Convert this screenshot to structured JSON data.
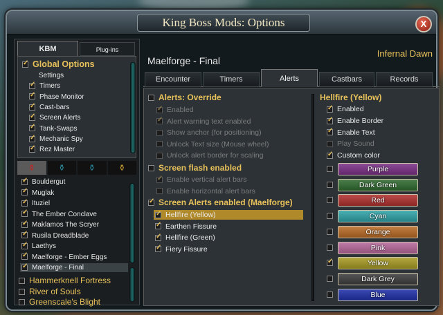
{
  "window": {
    "title": "King Boss Mods: Options",
    "close_label": "X"
  },
  "left_tabs": [
    "KBM",
    "Plug-ins"
  ],
  "options_tree": {
    "root": {
      "label": "Global Options",
      "checked": true
    },
    "items": [
      {
        "label": "Settings",
        "checked": null
      },
      {
        "label": "Timers",
        "checked": true
      },
      {
        "label": "Phase Monitor",
        "checked": true
      },
      {
        "label": "Cast-bars",
        "checked": true
      },
      {
        "label": "Screen Alerts",
        "checked": true
      },
      {
        "label": "Tank-Swaps",
        "checked": true
      },
      {
        "label": "Mechanic Spy",
        "checked": true
      },
      {
        "label": "Rez Master",
        "checked": true
      }
    ]
  },
  "boss_list": [
    {
      "label": "Bouldergut",
      "checked": true,
      "selected": false
    },
    {
      "label": "Muglak",
      "checked": true,
      "selected": false
    },
    {
      "label": "Ituziel",
      "checked": true,
      "selected": false
    },
    {
      "label": "The Ember Conclave",
      "checked": true,
      "selected": false
    },
    {
      "label": "Maklamos The Scryer",
      "checked": true,
      "selected": false
    },
    {
      "label": "Rusila Dreadblade",
      "checked": true,
      "selected": false
    },
    {
      "label": "Laethys",
      "checked": true,
      "selected": false
    },
    {
      "label": "Maelforge - Ember Eggs",
      "checked": true,
      "selected": false
    },
    {
      "label": "Maelforge - Final",
      "checked": true,
      "selected": true
    }
  ],
  "zones": [
    {
      "label": "Hammerknell Fortress",
      "checked": false
    },
    {
      "label": "River of Souls",
      "checked": false
    },
    {
      "label": "Greenscale's Blight",
      "checked": false
    }
  ],
  "header": {
    "encounter_name": "Maelforge - Final",
    "difficulty": "Infernal Dawn"
  },
  "tabs": [
    "Encounter",
    "Timers",
    "Alerts",
    "Castbars",
    "Records"
  ],
  "active_tab": "Alerts",
  "alerts": {
    "override": {
      "label": "Alerts: Override",
      "checked": false
    },
    "override_items": [
      {
        "label": "Enabled",
        "checked": true
      },
      {
        "label": "Alert warning text enabled",
        "checked": true
      },
      {
        "label": "Show anchor (for positioning)",
        "checked": false
      },
      {
        "label": "Unlock Text size (Mouse wheel)",
        "checked": false
      },
      {
        "label": "Unlock alert border for scaling",
        "checked": false
      }
    ],
    "flash": {
      "label": "Screen flash enabled",
      "checked": false
    },
    "flash_items": [
      {
        "label": "Enable vertical alert bars",
        "checked": true
      },
      {
        "label": "Enable horizontal alert bars",
        "checked": false
      }
    ],
    "screen_alerts": {
      "label": "Screen Alerts enabled (Maelforge)",
      "checked": true
    },
    "alert_list": [
      {
        "label": "Hellfire (Yellow)",
        "checked": true,
        "selected": true
      },
      {
        "label": "Earthen Fissure",
        "checked": true,
        "selected": false
      },
      {
        "label": "Hellfire (Green)",
        "checked": true,
        "selected": false
      },
      {
        "label": "Fiery Fissure",
        "checked": true,
        "selected": false
      }
    ]
  },
  "detail": {
    "title": "Hellfire (Yellow)",
    "options": [
      {
        "label": "Enabled",
        "checked": true,
        "disabled": false
      },
      {
        "label": "Enable Border",
        "checked": true,
        "disabled": false
      },
      {
        "label": "Enable Text",
        "checked": true,
        "disabled": false
      },
      {
        "label": "Play Sound",
        "checked": false,
        "disabled": true
      },
      {
        "label": "Custom color",
        "checked": true,
        "disabled": false
      }
    ],
    "colors": [
      {
        "name": "Purple",
        "hex": "#7a2f86",
        "checked": false
      },
      {
        "name": "Dark Green",
        "hex": "#2f6a2f",
        "checked": false
      },
      {
        "name": "Red",
        "hex": "#b0302e",
        "checked": false
      },
      {
        "name": "Cyan",
        "hex": "#2fa3a8",
        "checked": false
      },
      {
        "name": "Orange",
        "hex": "#b96a25",
        "checked": false
      },
      {
        "name": "Pink",
        "hex": "#b6679a",
        "checked": false
      },
      {
        "name": "Yellow",
        "hex": "#a79a22",
        "checked": true
      },
      {
        "name": "Dark Grey",
        "hex": "#3d3d3d",
        "checked": false
      },
      {
        "name": "Blue",
        "hex": "#1e2fa8",
        "checked": false
      }
    ]
  },
  "icons": [
    "close-icon",
    "scroll-up-icon",
    "scroll-down-icon",
    "potion-icon"
  ]
}
